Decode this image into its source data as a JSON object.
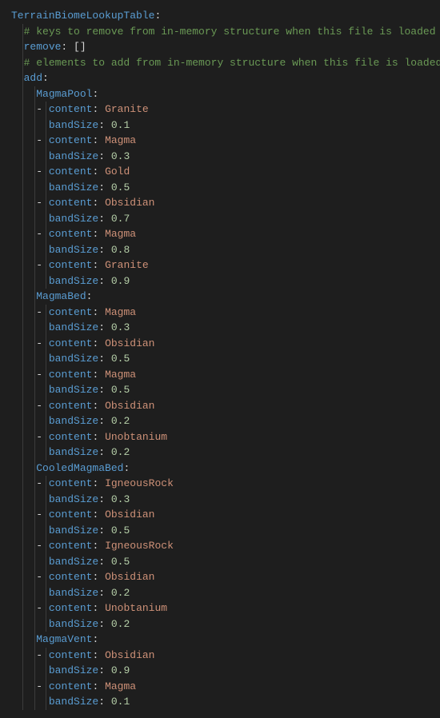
{
  "root_key": "TerrainBiomeLookupTable",
  "comments": {
    "remove": "# keys to remove from in-memory structure when this file is loaded",
    "add": "# elements to add from in-memory structure when this file is loaded"
  },
  "remove_key": "remove",
  "remove_value": "[]",
  "add_key": "add",
  "biomes": [
    {
      "name": "MagmaPool",
      "items": [
        {
          "content": "Granite",
          "bandSize": "0.1"
        },
        {
          "content": "Magma",
          "bandSize": "0.3"
        },
        {
          "content": "Gold",
          "bandSize": "0.5"
        },
        {
          "content": "Obsidian",
          "bandSize": "0.7"
        },
        {
          "content": "Magma",
          "bandSize": "0.8"
        },
        {
          "content": "Granite",
          "bandSize": "0.9"
        }
      ]
    },
    {
      "name": "MagmaBed",
      "items": [
        {
          "content": "Magma",
          "bandSize": "0.3"
        },
        {
          "content": "Obsidian",
          "bandSize": "0.5"
        },
        {
          "content": "Magma",
          "bandSize": "0.5"
        },
        {
          "content": "Obsidian",
          "bandSize": "0.2"
        },
        {
          "content": "Unobtanium",
          "bandSize": "0.2"
        }
      ]
    },
    {
      "name": "CooledMagmaBed",
      "items": [
        {
          "content": "IgneousRock",
          "bandSize": "0.3"
        },
        {
          "content": "Obsidian",
          "bandSize": "0.5"
        },
        {
          "content": "IgneousRock",
          "bandSize": "0.5"
        },
        {
          "content": "Obsidian",
          "bandSize": "0.2"
        },
        {
          "content": "Unobtanium",
          "bandSize": "0.2"
        }
      ]
    },
    {
      "name": "MagmaVent",
      "items": [
        {
          "content": "Obsidian",
          "bandSize": "0.9"
        },
        {
          "content": "Magma",
          "bandSize": "0.1"
        }
      ]
    }
  ],
  "labels": {
    "content": "content",
    "bandSize": "bandSize"
  }
}
